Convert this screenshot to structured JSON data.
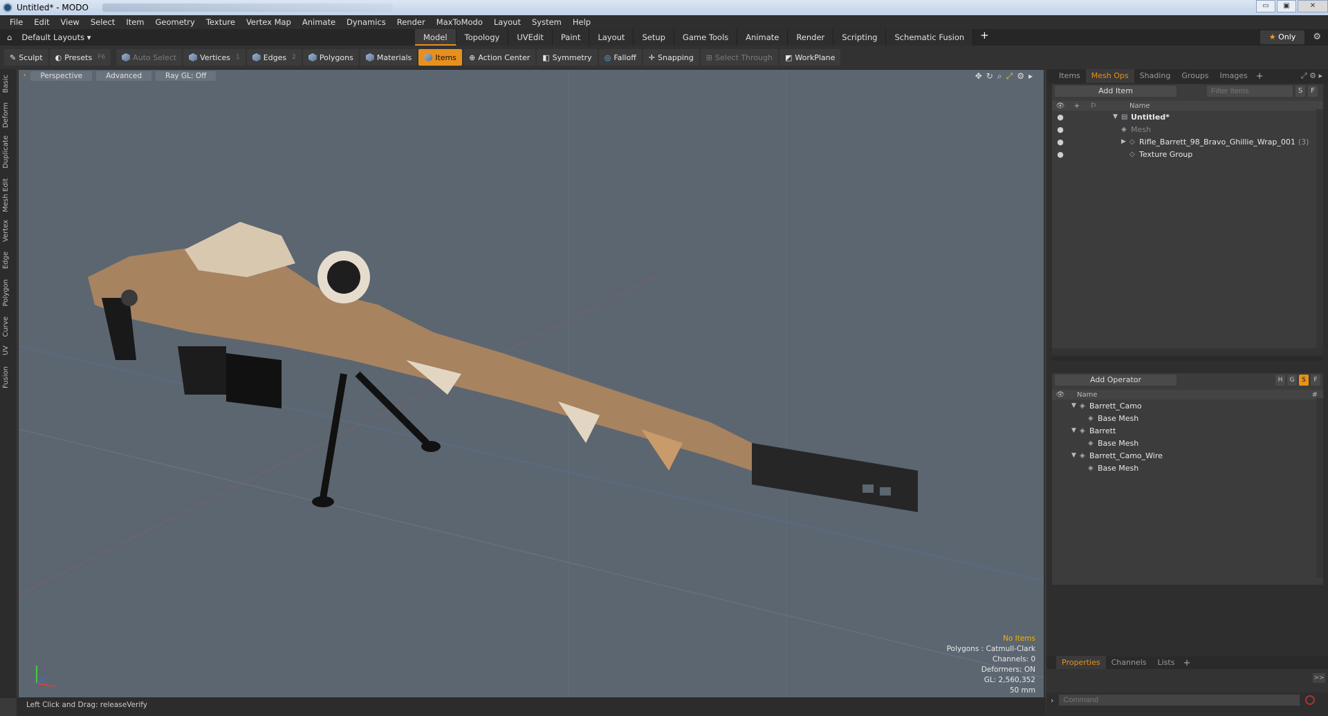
{
  "titlebar": {
    "title": "Untitled* - MODO",
    "controls": [
      "▭",
      "▣",
      "✕"
    ]
  },
  "menu": [
    "File",
    "Edit",
    "View",
    "Select",
    "Item",
    "Geometry",
    "Texture",
    "Vertex Map",
    "Animate",
    "Dynamics",
    "Render",
    "MaxToModo",
    "Layout",
    "System",
    "Help"
  ],
  "layout": {
    "selector": "Default Layouts ▾",
    "tabs": [
      "Model",
      "Topology",
      "UVEdit",
      "Paint",
      "Layout",
      "Setup",
      "Game Tools",
      "Animate",
      "Render",
      "Scripting",
      "Schematic Fusion"
    ],
    "active_tab": "Model",
    "plus": "+",
    "only_star": "★",
    "only_label": "Only"
  },
  "toolbar": {
    "sculpt": "Sculpt",
    "presets": "Presets",
    "presets_key": "F6",
    "auto_select": "Auto Select",
    "vertices": "Vertices",
    "vertices_key": "1",
    "edges": "Edges",
    "edges_key": "2",
    "polygons": "Polygons",
    "materials": "Materials",
    "items": "Items",
    "action_center": "Action Center",
    "symmetry": "Symmetry",
    "falloff": "Falloff",
    "snapping": "Snapping",
    "select_through": "Select Through",
    "workplane": "WorkPlane"
  },
  "left_tabs": [
    "Basic",
    "Deform",
    "Duplicate",
    "Mesh Edit",
    "Vertex",
    "Edge",
    "Polygon",
    "Curve",
    "UV",
    "Fusion"
  ],
  "viewport": {
    "perspective": "Perspective",
    "advanced": "Advanced",
    "raygl": "Ray GL: Off",
    "info": {
      "no_items": "No Items",
      "polygons": "Polygons : Catmull-Clark",
      "channels": "Channels: 0",
      "deformers": "Deformers: ON",
      "gl": "GL: 2,560,352",
      "mm": "50 mm"
    }
  },
  "status": {
    "text": "Left Click and Drag:   releaseVerify"
  },
  "right_tabs": [
    "Items",
    "Mesh Ops",
    "Shading",
    "Groups",
    "Images"
  ],
  "right_active": "Mesh Ops",
  "items_panel": {
    "add_item": "Add Item",
    "filter_placeholder": "Filter Items",
    "s": "S",
    "f": "F",
    "col_name": "Name",
    "rows": [
      {
        "name": "Untitled*",
        "count": ""
      },
      {
        "name": "Mesh",
        "count": ""
      },
      {
        "name": "Rifle_Barrett_98_Bravo_Ghillie_Wrap_001",
        "count": "(3)"
      },
      {
        "name": "Texture Group",
        "count": ""
      }
    ]
  },
  "ops_panel": {
    "add_operator": "Add Operator",
    "h": "H",
    "g": "G",
    "s": "S",
    "f": "F",
    "col_name": "Name",
    "col_hash": "#",
    "rows": [
      {
        "name": "Barrett_Camo"
      },
      {
        "name": "Base Mesh"
      },
      {
        "name": "Barrett"
      },
      {
        "name": "Base Mesh"
      },
      {
        "name": "Barrett_Camo_Wire"
      },
      {
        "name": "Base Mesh"
      }
    ]
  },
  "props": {
    "tabs": [
      "Properties",
      "Channels",
      "Lists"
    ],
    "active": "Properties",
    "expand": ">>",
    "command_placeholder": "Command"
  },
  "colors": {
    "accent": "#e8901c",
    "viewport_bg": "#5c6670"
  }
}
